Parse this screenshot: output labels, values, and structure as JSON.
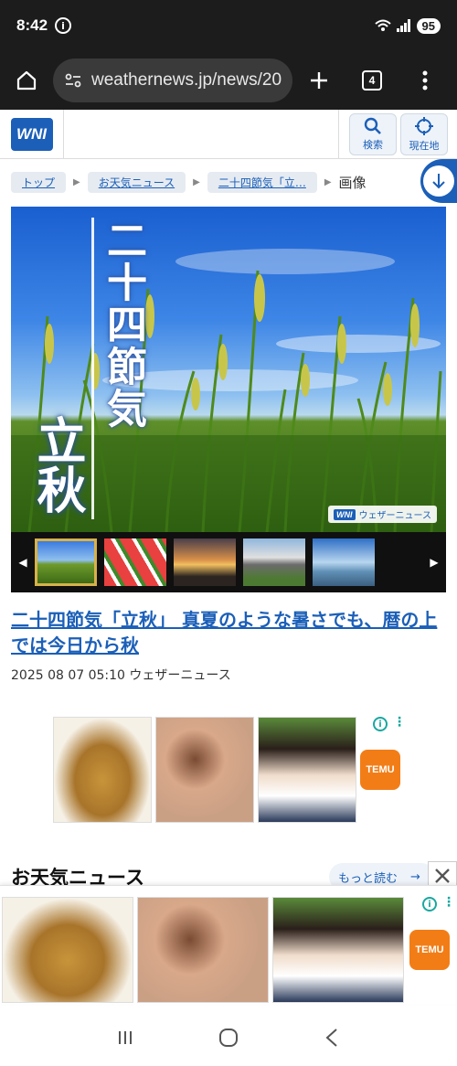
{
  "status_bar": {
    "time": "8:42",
    "info_glyph": "i",
    "battery": "95"
  },
  "browser": {
    "url": "weathernews.jp/news/20",
    "tab_count": "4"
  },
  "site": {
    "logo": "WNI",
    "search_label": "検索",
    "location_label": "現在地"
  },
  "breadcrumb": {
    "items": [
      "トップ",
      "お天気ニュース",
      "二十四節気「立…"
    ],
    "current": "画像"
  },
  "hero": {
    "vertical_title": "二十四節気",
    "big_title": "立秋",
    "watermark": "ウェザーニュース"
  },
  "article": {
    "headline": "二十四節気「立秋」 真夏のような暑さでも、暦の上では今日から秋",
    "dateline": "2025 08 07 05:10 ウェザーニュース"
  },
  "ad": {
    "brand": "TEMU"
  },
  "section": {
    "title": "お天気ニュース",
    "more_label": "もっと読む"
  },
  "colors": {
    "brand_blue": "#1b5fb8",
    "temu_orange": "#f27d17",
    "ad_teal": "#19a7a0"
  }
}
